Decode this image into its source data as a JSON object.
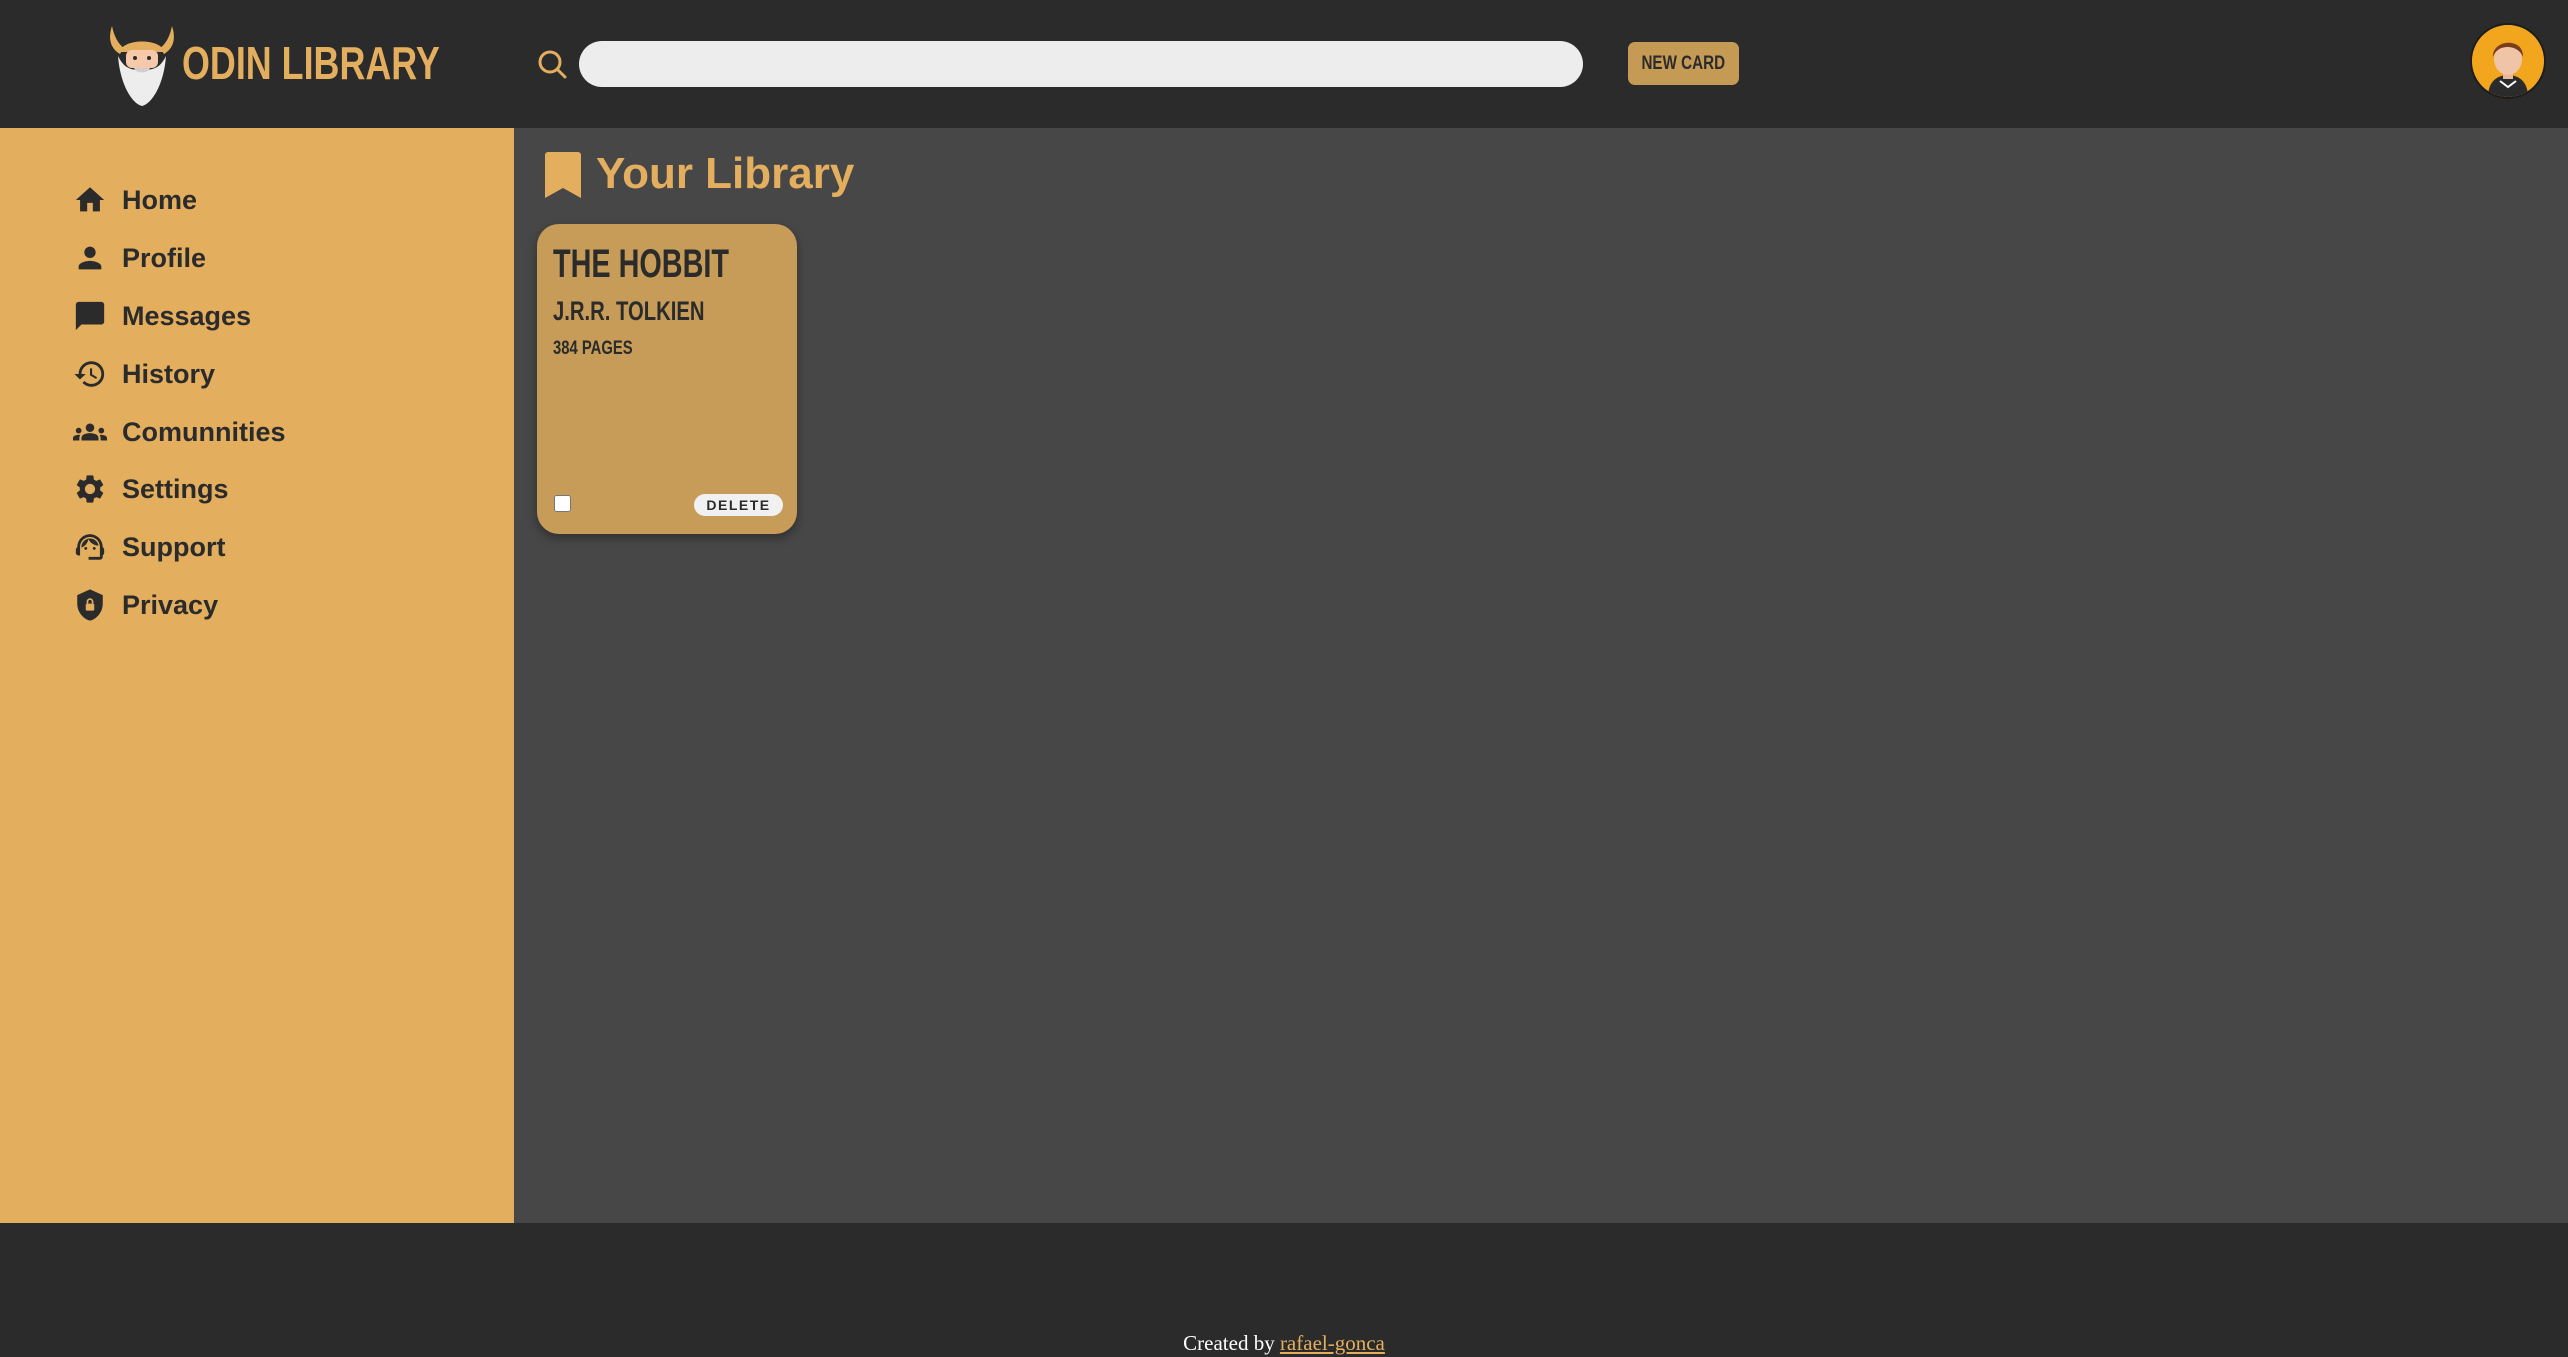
{
  "header": {
    "brand": "ODIN LIBRARY",
    "search": {
      "value": "",
      "placeholder": ""
    },
    "new_card_label": "NEW CARD"
  },
  "sidebar": {
    "items": [
      {
        "label": "Home",
        "icon": "home-icon"
      },
      {
        "label": "Profile",
        "icon": "person-icon"
      },
      {
        "label": "Messages",
        "icon": "chat-bubble-icon"
      },
      {
        "label": "History",
        "icon": "history-icon"
      },
      {
        "label": "Comunnities",
        "icon": "group-icon"
      },
      {
        "label": "Settings",
        "icon": "gear-icon"
      },
      {
        "label": "Support",
        "icon": "support-agent-icon"
      },
      {
        "label": "Privacy",
        "icon": "shield-lock-icon"
      }
    ]
  },
  "main": {
    "title": "Your Library",
    "title_icon": "bookmark-icon",
    "cards": [
      {
        "title": "THE HOBBIT",
        "author": "J.R.R. TOLKIEN",
        "pages": "384 PAGES",
        "read": false,
        "delete_label": "DELETE"
      }
    ]
  },
  "footer": {
    "prefix": "Created by",
    "link": "rafael-gonca"
  },
  "colors": {
    "accent": "#e3ae5e",
    "card": "#c69c58",
    "header_bg": "#2b2b2b",
    "main_bg": "#474747",
    "button_bg": "#c59a55"
  }
}
